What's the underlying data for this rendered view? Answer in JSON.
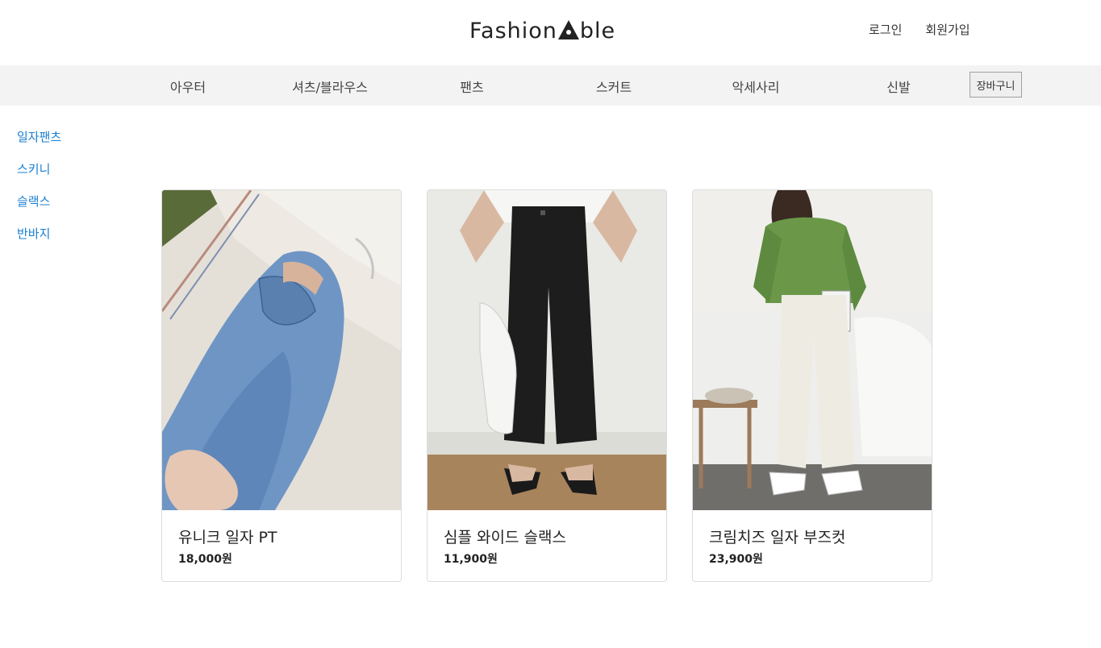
{
  "header": {
    "logo_text_left": "Fashion",
    "logo_text_right": "ble",
    "login": "로그인",
    "signup": "회원가입"
  },
  "nav": {
    "items": [
      {
        "label": "아우터"
      },
      {
        "label": "셔츠/블라우스"
      },
      {
        "label": "팬츠"
      },
      {
        "label": "스커트"
      },
      {
        "label": "악세사리"
      },
      {
        "label": "신발"
      }
    ],
    "cart_label": "장바구니"
  },
  "sidebar": {
    "items": [
      {
        "label": "일자팬츠"
      },
      {
        "label": "스키니"
      },
      {
        "label": "슬랙스"
      },
      {
        "label": "반바지"
      }
    ]
  },
  "products": [
    {
      "name": "유니크 일자 PT",
      "price": "18,000원"
    },
    {
      "name": "심플 와이드 슬랙스",
      "price": "11,900원"
    },
    {
      "name": "크림치즈 일자 부즈컷",
      "price": "23,900원"
    }
  ],
  "colors": {
    "nav_bg": "#f4f3f3",
    "sidebar_link": "#1a7fd0"
  }
}
